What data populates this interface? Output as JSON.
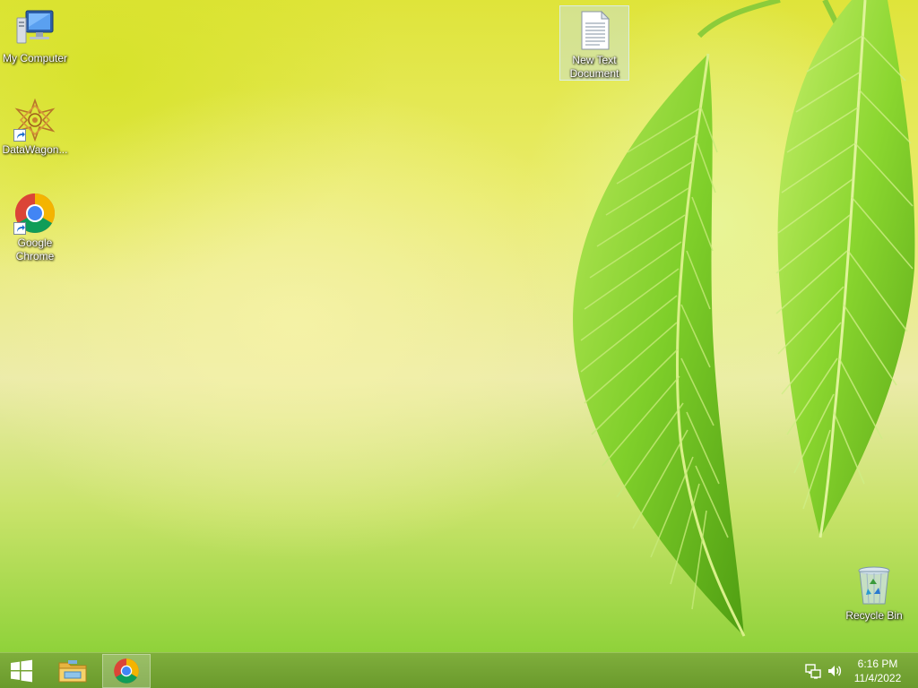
{
  "desktop": {
    "icons": [
      {
        "label": "My Computer",
        "icon": "computer-icon"
      },
      {
        "label": "DataWagon...",
        "icon": "datawagon-icon"
      },
      {
        "label": "Google Chrome",
        "icon": "chrome-icon"
      },
      {
        "label": "New Text Document",
        "icon": "text-document-icon",
        "selected": true
      },
      {
        "label": "Recycle Bin",
        "icon": "recycle-bin-icon"
      }
    ]
  },
  "taskbar": {
    "start_icon": "windows-logo-icon",
    "pinned": [
      {
        "icon": "file-explorer-icon"
      },
      {
        "icon": "chrome-icon",
        "active": true
      }
    ],
    "tray": [
      {
        "icon": "network-icon"
      },
      {
        "icon": "volume-icon"
      }
    ],
    "clock": {
      "time": "6:16 PM",
      "date": "11/4/2022"
    }
  },
  "colors": {
    "taskbar": "#6f9f31",
    "wallpaper_accent": "#8fd23a"
  }
}
